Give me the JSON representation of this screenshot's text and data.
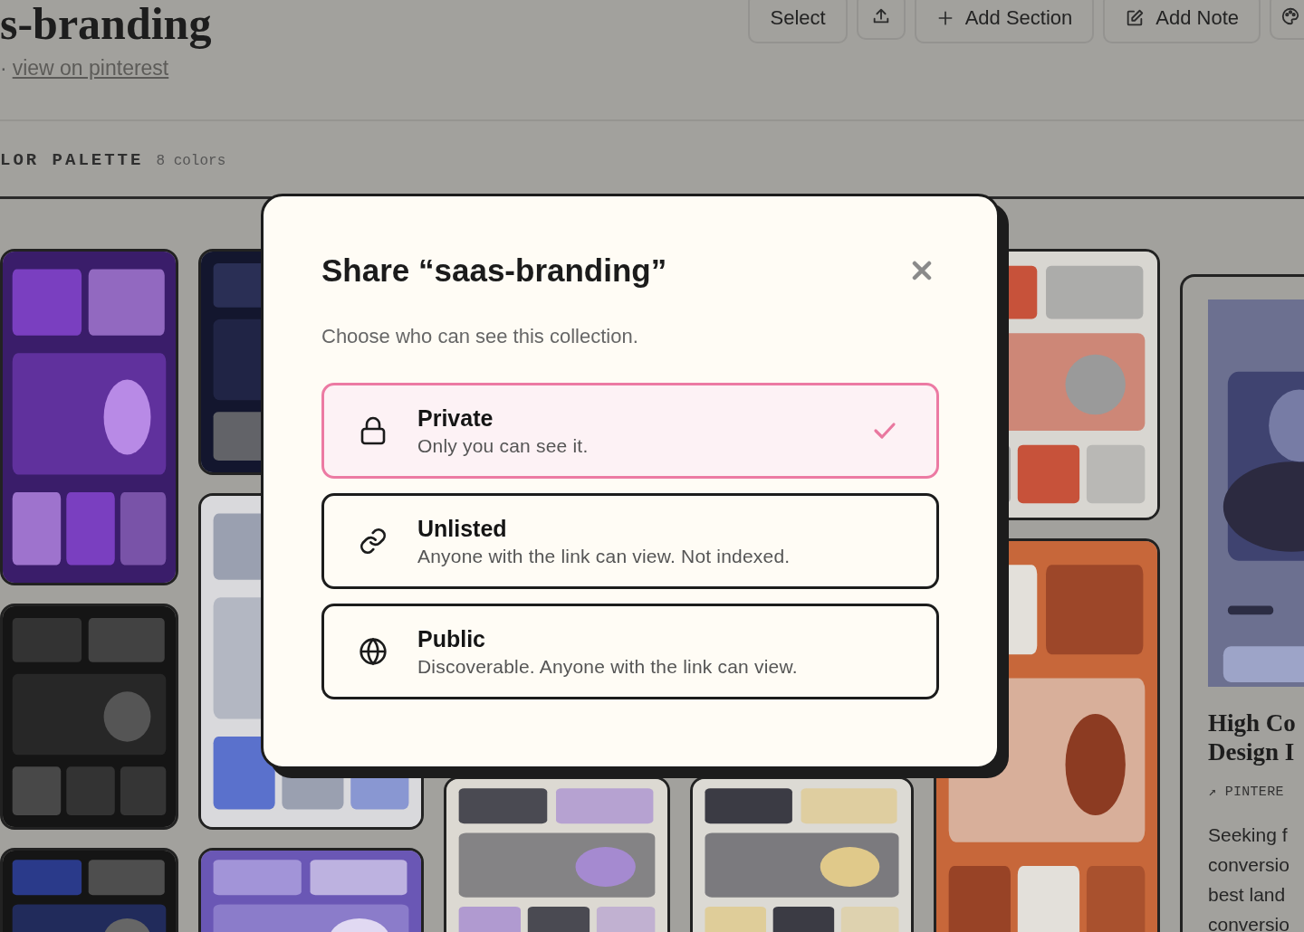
{
  "header": {
    "title": "s-branding",
    "separator": "·",
    "link": "view on pinterest"
  },
  "toolbar": [
    {
      "kind": "text",
      "label": "Select"
    },
    {
      "kind": "upload"
    },
    {
      "kind": "plus",
      "label": "Add Section"
    },
    {
      "kind": "pencil",
      "label": "Add Note"
    },
    {
      "kind": "palette"
    }
  ],
  "palette": {
    "label": "LOR PALETTE",
    "count": "8 colors"
  },
  "board": {
    "columns": [
      {
        "pins": [
          {
            "kind": "picture"
          },
          {
            "kind": "picture"
          },
          {
            "kind": "picture"
          }
        ]
      },
      {
        "pins": [
          {
            "kind": "picture"
          },
          {
            "kind": "picture"
          },
          {
            "kind": "picture"
          }
        ]
      },
      {
        "pins": [
          {
            "kind": "picture"
          }
        ]
      },
      {
        "pins": [
          {
            "kind": "picture"
          }
        ]
      },
      {
        "pins": [
          {
            "kind": "picture"
          },
          {
            "kind": "picture"
          }
        ]
      },
      {
        "pins": [
          {
            "kind": "card",
            "title_lines": [
              "High Co",
              "Design I"
            ],
            "source": "↗ PINTERE",
            "description_lines": [
              "Seeking f",
              "conversio",
              "best land",
              "conversio"
            ]
          }
        ]
      }
    ]
  },
  "dialog": {
    "title": "Share “saas-branding”",
    "subtitle": "Choose who can see this collection.",
    "options": [
      {
        "kind": "lock",
        "label": "Private",
        "description": "Only you can see it.",
        "selected": true
      },
      {
        "kind": "link",
        "label": "Unlisted",
        "description": "Anyone with the link can view. Not indexed.",
        "selected": false
      },
      {
        "kind": "globe",
        "label": "Public",
        "description": "Discoverable. Anyone with the link can view.",
        "selected": false
      }
    ]
  }
}
